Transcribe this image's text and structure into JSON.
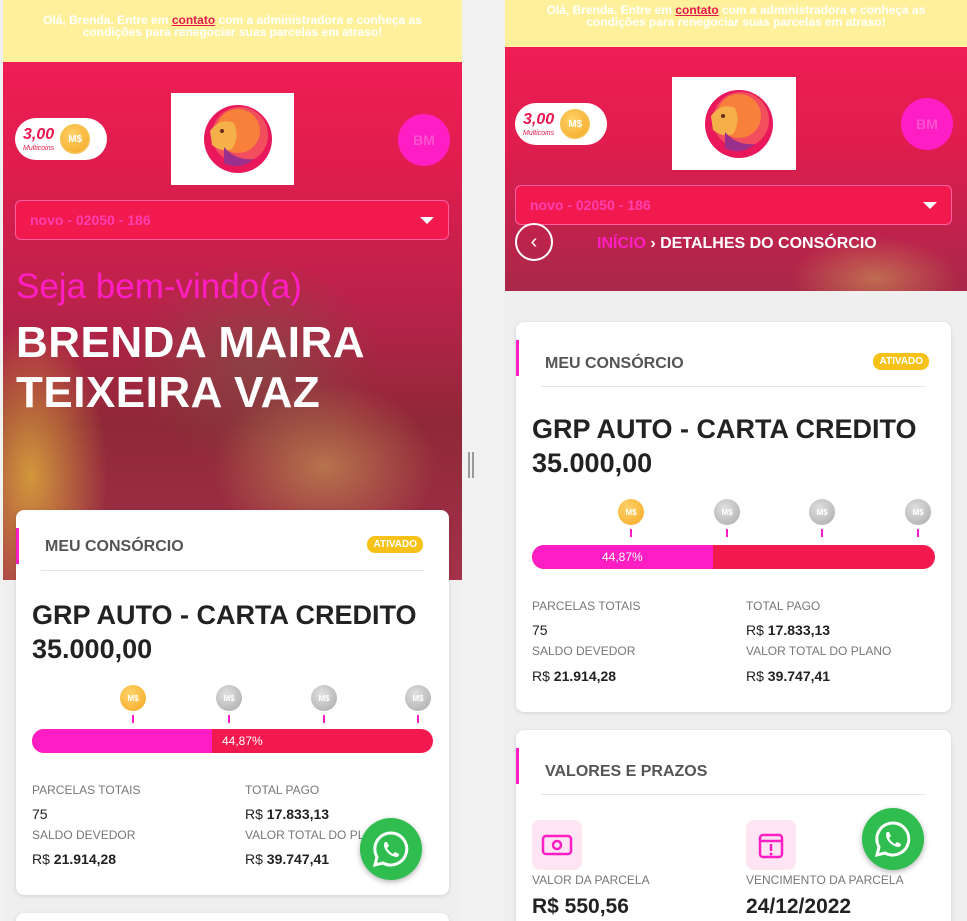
{
  "notice": {
    "before": "Olá, Brenda. Entre em ",
    "link": "contato",
    "after": " com a administradora e conheça as condições para renegociar suas parcelas em atraso!"
  },
  "header": {
    "coins_value": "3,00",
    "coins_label": "Multicoins",
    "coin_symbol": "M$",
    "avatar_initials": "BM",
    "select_value": "novo - 02050 - 186"
  },
  "welcome": {
    "greeting": "Seja bem-vindo(a)",
    "name_line1": "BRENDA MAIRA",
    "name_line2": "TEIXEIRA VAZ"
  },
  "breadcrumb": {
    "home": "INÍCIO",
    "separator": "›",
    "current": "DETALHES DO CONSÓRCIO"
  },
  "consorcio": {
    "title": "MEU CONSÓRCIO",
    "status": "ATIVADO",
    "plan_line1": "GRP AUTO - CARTA CREDITO",
    "plan_line2": "35.000,00",
    "progress_pct": 44.87,
    "progress_label": "44,87%",
    "milestone_symbol": "M$",
    "labels": {
      "parcelas": "PARCELAS TOTAIS",
      "total_pago": "TOTAL PAGO",
      "saldo": "SALDO DEVEDOR",
      "valor_total": "VALOR TOTAL DO PLANO"
    },
    "values": {
      "parcelas": "75",
      "currency": "R$",
      "total_pago": "17.833,13",
      "saldo": "21.914,28",
      "valor_total": "39.747,41"
    }
  },
  "valores": {
    "title": "VALORES E PRAZOS",
    "parcela_label": "VALOR DA PARCELA",
    "parcela_value": "R$ 550,56",
    "vencimento_label": "VENCIMENTO DA PARCELA",
    "vencimento_value": "24/12/2022"
  },
  "colors": {
    "accent": "#ff1ec3",
    "primary": "#f2194f",
    "badge": "#f7c218",
    "whatsapp": "#2ebd4e"
  }
}
